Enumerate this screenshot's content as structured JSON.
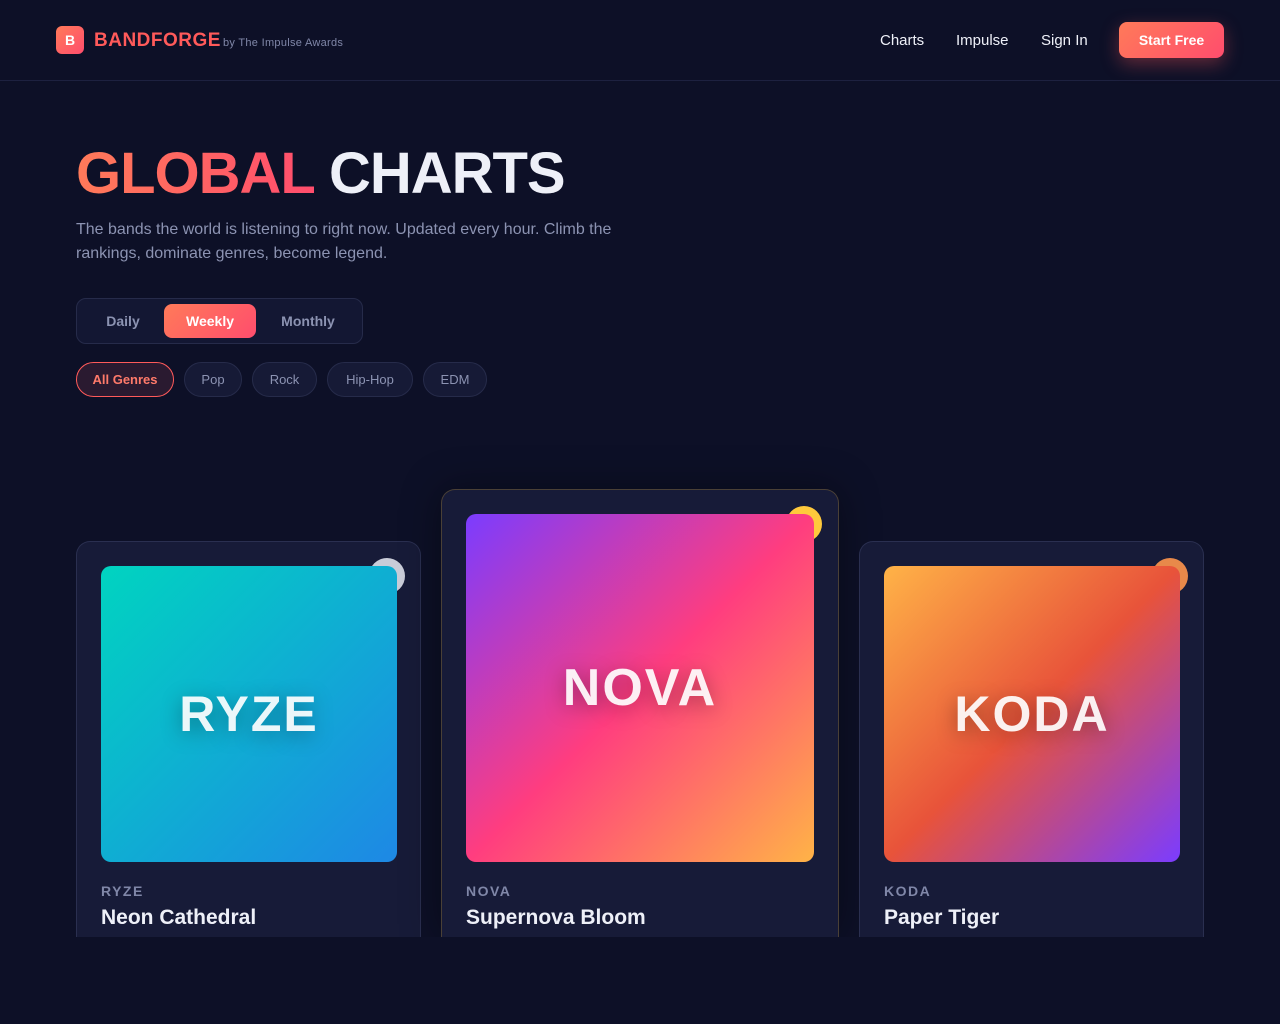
{
  "header": {
    "logo_letter": "B",
    "brand": "BANDFORGE",
    "brand_sub": "by The Impulse Awards",
    "nav": [
      "Charts",
      "Impulse",
      "Sign In"
    ],
    "cta": "Start Free"
  },
  "hero": {
    "title_accent": "GLOBAL",
    "title_rest": "CHARTS",
    "description": "The bands the world is listening to right now. Updated every hour. Climb the rankings, dominate genres, become legend."
  },
  "period": {
    "options": [
      "Daily",
      "Weekly",
      "Monthly"
    ],
    "selected": "Weekly"
  },
  "genres": {
    "options": [
      "All Genres",
      "Pop",
      "Rock",
      "Hip-Hop",
      "EDM"
    ],
    "selected": "All Genres"
  },
  "podium": [
    {
      "band": "RYZE",
      "cover_text": "RYZE",
      "title": "Neon Cathedral",
      "medal": "silver",
      "medal_color": "#c9ccd8",
      "gradient": [
        "#00d4c0",
        "#1e88e5"
      ]
    },
    {
      "band": "NOVA",
      "cover_text": "NOVA",
      "title": "Supernova Bloom",
      "medal": "gold",
      "medal_color": "#ffc93c",
      "gradient": [
        "#7b3cff",
        "#ff3d7f",
        "#ffb347"
      ]
    },
    {
      "band": "KODA",
      "cover_text": "KODA",
      "title": "Paper Tiger",
      "medal": "bronze",
      "medal_color": "#e8894a",
      "gradient": [
        "#ffb347",
        "#e8533a",
        "#7b3cff"
      ]
    }
  ]
}
